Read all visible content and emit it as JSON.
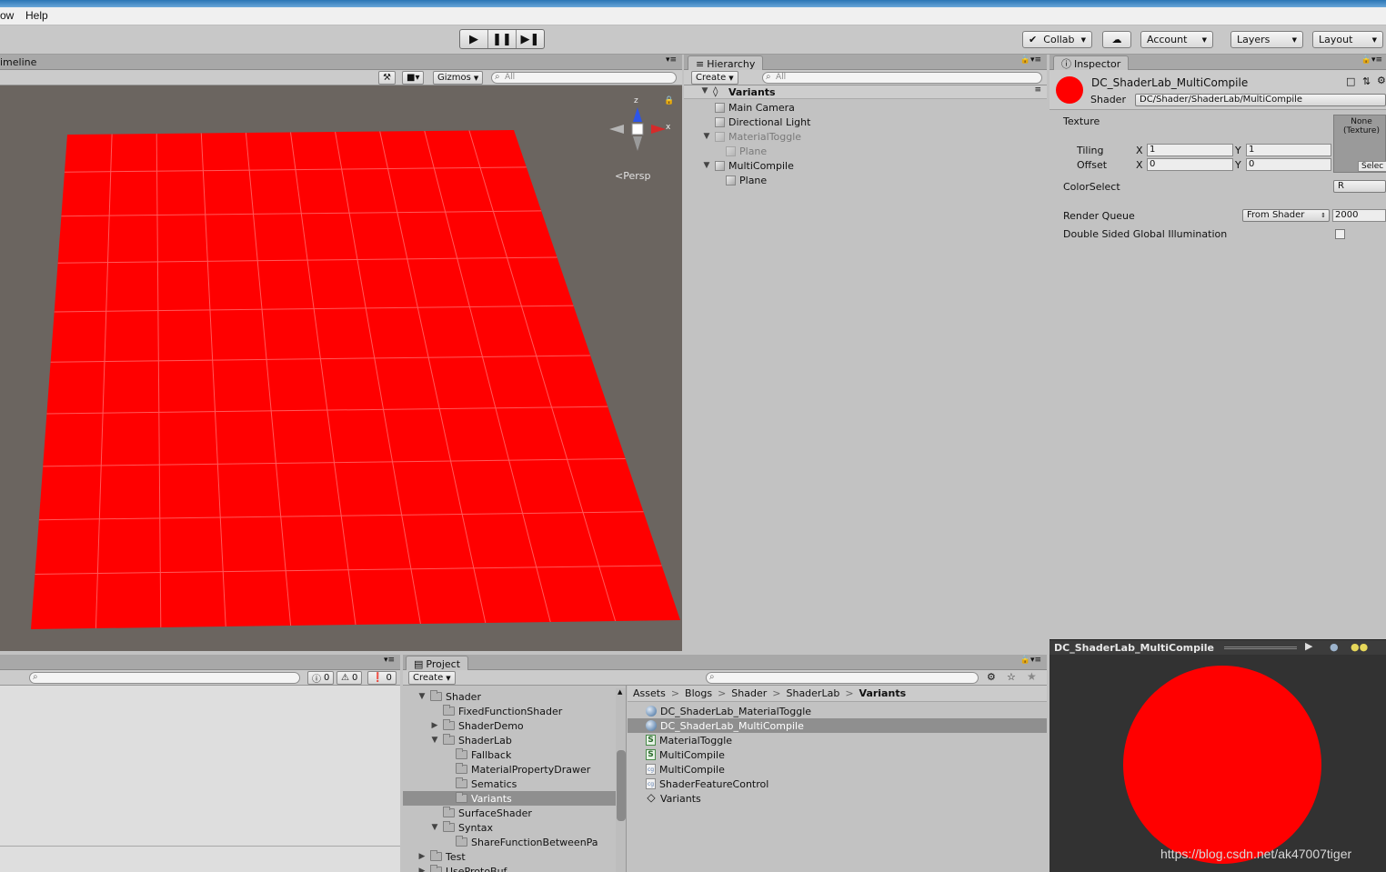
{
  "menubar": {
    "items": [
      "ow",
      "Help"
    ]
  },
  "toolbar": {
    "collab": "Collab",
    "account": "Account",
    "layers": "Layers",
    "layout": "Layout"
  },
  "scene": {
    "tab": "imeline",
    "gizmos": "Gizmos",
    "search_placeholder": "All",
    "persp": "Persp",
    "axis_x": "x",
    "axis_z": "z",
    "plane_color": "#ff0000"
  },
  "hierarchy": {
    "tab": "Hierarchy",
    "create": "Create",
    "search_placeholder": "All",
    "scene": "Variants",
    "items": [
      {
        "label": "Main Camera",
        "depth": 1,
        "dim": false,
        "arrow": ""
      },
      {
        "label": "Directional Light",
        "depth": 1,
        "dim": false,
        "arrow": ""
      },
      {
        "label": "MaterialToggle",
        "depth": 1,
        "dim": true,
        "arrow": "▼"
      },
      {
        "label": "Plane",
        "depth": 2,
        "dim": true,
        "arrow": ""
      },
      {
        "label": "MultiCompile",
        "depth": 1,
        "dim": false,
        "arrow": "▼"
      },
      {
        "label": "Plane",
        "depth": 2,
        "dim": false,
        "arrow": ""
      }
    ]
  },
  "inspector": {
    "tab": "Inspector",
    "material_name": "DC_ShaderLab_MultiCompile",
    "shader_label": "Shader",
    "shader_value": "DC/Shader/ShaderLab/MultiCompile",
    "texture_label": "Texture",
    "texture_none": "None",
    "texture_type": "(Texture)",
    "texture_select": "Selec",
    "tiling_label": "Tiling",
    "offset_label": "Offset",
    "x_label": "X",
    "y_label": "Y",
    "tiling_x": "1",
    "tiling_y": "1",
    "offset_x": "0",
    "offset_y": "0",
    "colorselect_label": "ColorSelect",
    "colorselect_value": "R",
    "render_queue_label": "Render Queue",
    "render_queue_mode": "From Shader",
    "render_queue_value": "2000",
    "dsgi_label": "Double Sided Global Illumination"
  },
  "preview": {
    "title": "DC_ShaderLab_MultiCompile",
    "sphere_color": "#ff0000"
  },
  "console": {
    "count_info": "0",
    "count_warn": "0",
    "count_error": "0"
  },
  "project": {
    "tab": "Project",
    "create": "Create",
    "breadcrumb": [
      "Assets",
      "Blogs",
      "Shader",
      "ShaderLab",
      "Variants"
    ],
    "tree": [
      {
        "label": "Shader",
        "depth": 0,
        "arrow": "▼",
        "selected": false
      },
      {
        "label": "FixedFunctionShader",
        "depth": 1,
        "arrow": "",
        "selected": false
      },
      {
        "label": "ShaderDemo",
        "depth": 1,
        "arrow": "▶",
        "selected": false
      },
      {
        "label": "ShaderLab",
        "depth": 1,
        "arrow": "▼",
        "selected": false
      },
      {
        "label": "Fallback",
        "depth": 2,
        "arrow": "",
        "selected": false
      },
      {
        "label": "MaterialPropertyDrawer",
        "depth": 2,
        "arrow": "",
        "selected": false
      },
      {
        "label": "Sematics",
        "depth": 2,
        "arrow": "",
        "selected": false
      },
      {
        "label": "Variants",
        "depth": 2,
        "arrow": "",
        "selected": true
      },
      {
        "label": "SurfaceShader",
        "depth": 1,
        "arrow": "",
        "selected": false
      },
      {
        "label": "Syntax",
        "depth": 1,
        "arrow": "▼",
        "selected": false
      },
      {
        "label": "ShareFunctionBetweenPa",
        "depth": 2,
        "arrow": "",
        "selected": false
      },
      {
        "label": "Test",
        "depth": 0,
        "arrow": "▶",
        "selected": false
      },
      {
        "label": "UseProtoBuf",
        "depth": 0,
        "arrow": "▶",
        "selected": false
      }
    ],
    "assets": [
      {
        "label": "DC_ShaderLab_MaterialToggle",
        "icon": "material",
        "selected": false
      },
      {
        "label": "DC_ShaderLab_MultiCompile",
        "icon": "material",
        "selected": true
      },
      {
        "label": "MaterialToggle",
        "icon": "shader",
        "selected": false
      },
      {
        "label": "MultiCompile",
        "icon": "shader",
        "selected": false
      },
      {
        "label": "MultiCompile",
        "icon": "cginc",
        "selected": false
      },
      {
        "label": "ShaderFeatureControl",
        "icon": "cginc",
        "selected": false
      },
      {
        "label": "Variants",
        "icon": "scene",
        "selected": false
      }
    ]
  },
  "watermark": "https://blog.csdn.net/ak47007tiger"
}
